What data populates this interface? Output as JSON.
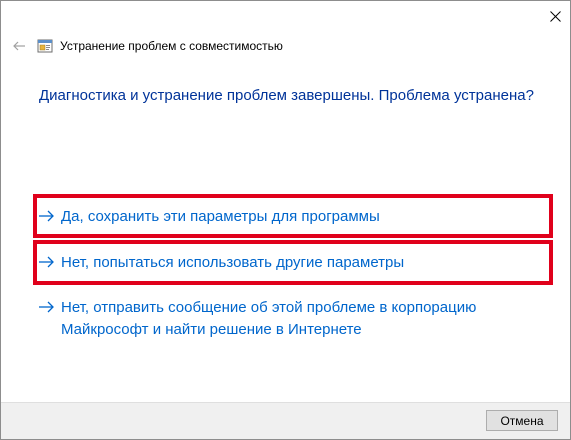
{
  "window": {
    "title": "Устранение проблем с совместимостью"
  },
  "main": {
    "question": "Диагностика и устранение проблем завершены. Проблема устранена?",
    "options": [
      {
        "label": "Да, сохранить эти параметры для программы"
      },
      {
        "label": "Нет, попытаться использовать другие параметры"
      },
      {
        "label_line1": "Нет, отправить сообщение об этой проблеме в корпорацию",
        "label_line2": "Майкрософт и найти решение в Интернете"
      }
    ]
  },
  "footer": {
    "cancel_label": "Отмена"
  },
  "colors": {
    "question_text": "#003399",
    "link_text": "#0066cc",
    "highlight_border": "#e0001b",
    "footer_bg": "#f0f0f0"
  },
  "icons": {
    "close": "close-icon",
    "back": "back-arrow-icon",
    "app": "troubleshooter-app-icon",
    "option_arrow": "arrow-right-icon"
  }
}
